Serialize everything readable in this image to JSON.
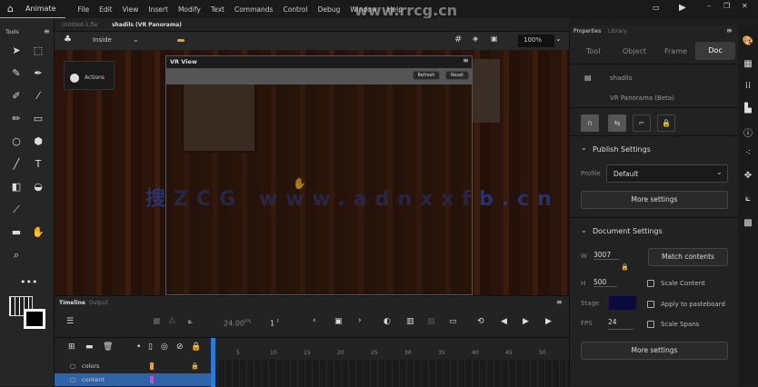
{
  "app": {
    "name": "Animate",
    "menus": [
      "File",
      "Edit",
      "View",
      "Insert",
      "Modify",
      "Text",
      "Commands",
      "Control",
      "Debug",
      "Window",
      "Help"
    ]
  },
  "watermarks": {
    "top": "www.rrcg.cn",
    "center": "搜ZCG www.adnxxfb.cn"
  },
  "doc_tabs": [
    {
      "label": "Untitled-1.fla",
      "active": false
    },
    {
      "label": "shadils (VR Panorama)",
      "active": true
    }
  ],
  "edit_bar": {
    "scene": "Inside",
    "zoom": "100%"
  },
  "tools_panel": {
    "title": "Tools"
  },
  "actions_panel": {
    "label": "Actions"
  },
  "vr_view": {
    "title": "VR View",
    "buttons": [
      "Refresh",
      "Reset"
    ]
  },
  "properties": {
    "tabs": [
      "Properties",
      "Library"
    ],
    "subtabs": [
      "Tool",
      "Object",
      "Frame",
      "Doc"
    ],
    "active_subtab": "Doc",
    "doc_name": "shadils",
    "doc_type": "VR Panorama (Beta)",
    "publish": {
      "title": "Publish Settings",
      "profile_label": "Profile",
      "profile": "Default",
      "more": "More settings"
    },
    "document": {
      "title": "Document Settings",
      "w_label": "W",
      "w": "3007",
      "h_label": "H",
      "h": "500",
      "stage_label": "Stage",
      "stage_color": "#0a0a3c",
      "fps_label": "FPS",
      "fps": "24",
      "match": "Match contents",
      "checks": [
        {
          "label": "Scale Content",
          "checked": false
        },
        {
          "label": "Apply to pasteboard",
          "checked": false
        },
        {
          "label": "Scale Spans",
          "checked": false
        }
      ],
      "more": "More settings"
    }
  },
  "timeline": {
    "tabs": [
      "Timeline",
      "Output"
    ],
    "fps": "24.00",
    "fps_unit": "FPS",
    "frame": "1",
    "frame_unit": "F",
    "ruler": [
      "5",
      "10",
      "15",
      "20",
      "25",
      "30",
      "35",
      "40",
      "45",
      "50"
    ],
    "layers": [
      {
        "name": "colors",
        "color": "#f0a020",
        "locked": true,
        "selected": false
      },
      {
        "name": "content",
        "color": "#c050d0",
        "locked": false,
        "selected": true
      }
    ]
  }
}
